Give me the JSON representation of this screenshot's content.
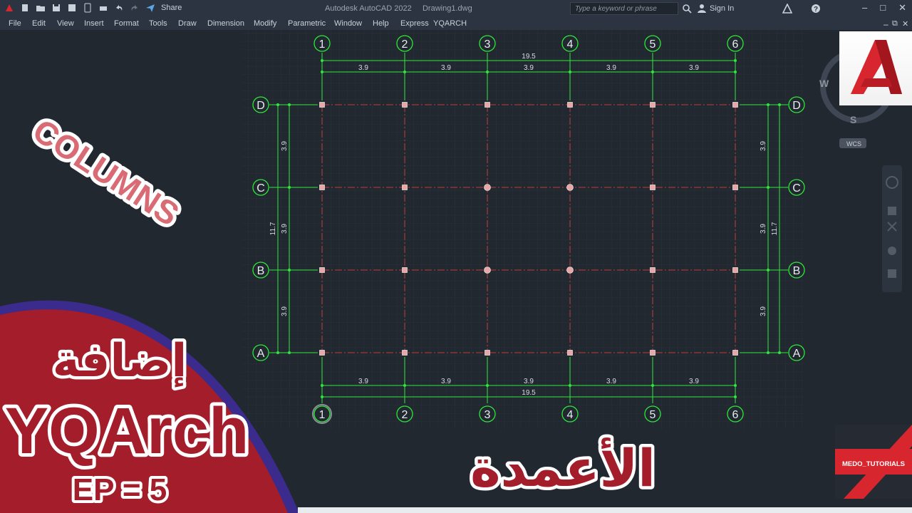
{
  "titlebar": {
    "share_label": "Share",
    "app_title": "Autodesk AutoCAD 2022",
    "document": "Drawing1.dwg",
    "search_placeholder": "Type a keyword or phrase",
    "sign_in": "Sign In"
  },
  "menu": [
    "File",
    "Edit",
    "View",
    "Insert",
    "Format",
    "Tools",
    "Draw",
    "Dimension",
    "Modify",
    "Parametric",
    "Window",
    "Help",
    "Express",
    "YQARCH"
  ],
  "drawing": {
    "column_labels": [
      "1",
      "2",
      "3",
      "4",
      "5",
      "6"
    ],
    "row_labels": [
      "D",
      "C",
      "B",
      "A"
    ],
    "bay_dimension": "3.9",
    "total_width": "19.5",
    "total_height": "11.7"
  },
  "viewcube": {
    "west": "W",
    "south": "S",
    "wcs": "WCS"
  },
  "overlay": {
    "columns_tag": "COLUMNS",
    "arabic_add": "إضافة",
    "plugin_name": "YQArch",
    "episode": "EP = 5",
    "arabic_columns": "الأعمدة",
    "channel": "MEDO_TUTORIALS"
  },
  "colors": {
    "grid_green": "#2ee83a",
    "axis_red": "#c23a3a",
    "column_fill": "#e8a6a6",
    "banner": "#a31d2a",
    "banner_edge": "#3a2b8c"
  }
}
